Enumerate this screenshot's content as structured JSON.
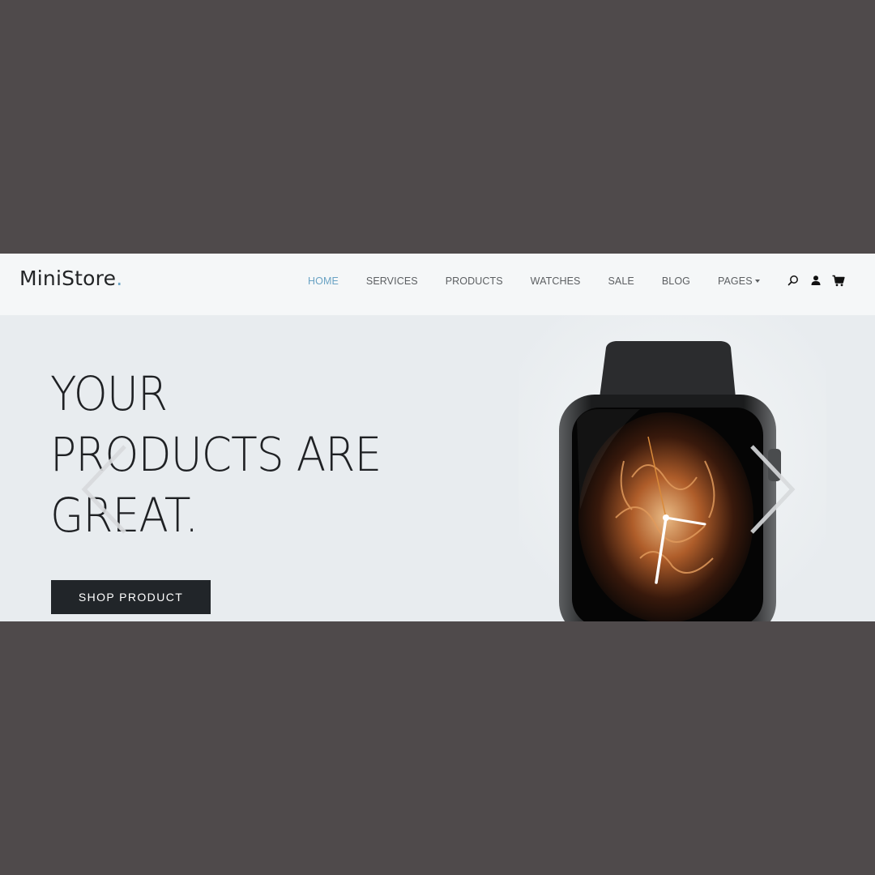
{
  "header": {
    "logo": {
      "text": "MiniStore",
      "dot": "."
    },
    "nav": [
      {
        "label": "HOME",
        "active": true
      },
      {
        "label": "SERVICES",
        "active": false
      },
      {
        "label": "PRODUCTS",
        "active": false
      },
      {
        "label": "WATCHES",
        "active": false
      },
      {
        "label": "SALE",
        "active": false
      },
      {
        "label": "BLOG",
        "active": false
      },
      {
        "label": "PAGES",
        "active": false,
        "dropdown": true
      }
    ],
    "tools": [
      "search-icon",
      "user-icon",
      "cart-icon"
    ]
  },
  "hero": {
    "title_lines": [
      "YOUR",
      "PRODUCTS ARE",
      "GREAT."
    ],
    "button_label": "SHOP PRODUCT",
    "slider_controls": [
      "chevron-left-icon",
      "chevron-right-icon"
    ]
  },
  "colors": {
    "outer_background": "#4f4a4b",
    "header_background": "#f5f7f8",
    "hero_background": "#e8ecef",
    "accent": "#6aa3c4",
    "text_dark": "#1f2124",
    "button": "#212529"
  }
}
